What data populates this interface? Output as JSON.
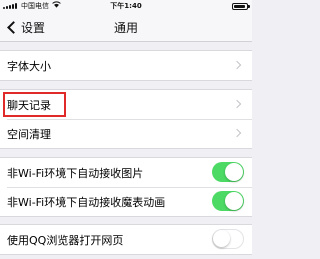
{
  "status_bar": {
    "carrier": "中国电信",
    "wifi_icon": "wifi-icon",
    "time": "下午1:40",
    "battery_icon": "battery-icon"
  },
  "nav": {
    "back_label": "设置",
    "title": "通用"
  },
  "groups": [
    {
      "rows": [
        {
          "label": "字体大小",
          "accessory": "chevron"
        }
      ]
    },
    {
      "rows": [
        {
          "label": "聊天记录",
          "accessory": "chevron",
          "highlighted": true
        },
        {
          "label": "空间清理",
          "accessory": "chevron"
        }
      ]
    },
    {
      "rows": [
        {
          "label": "非Wi-Fi环境下自动接收图片",
          "accessory": "switch",
          "on": true
        },
        {
          "label": "非Wi-Fi环境下自动接收魔表动画",
          "accessory": "switch",
          "on": true
        }
      ]
    },
    {
      "rows": [
        {
          "label": "使用QQ浏览器打开网页",
          "accessory": "switch",
          "on": false
        }
      ]
    }
  ],
  "colors": {
    "switch_on": "#4cd964",
    "highlight": "#e02a2a",
    "background": "#efeff4"
  }
}
